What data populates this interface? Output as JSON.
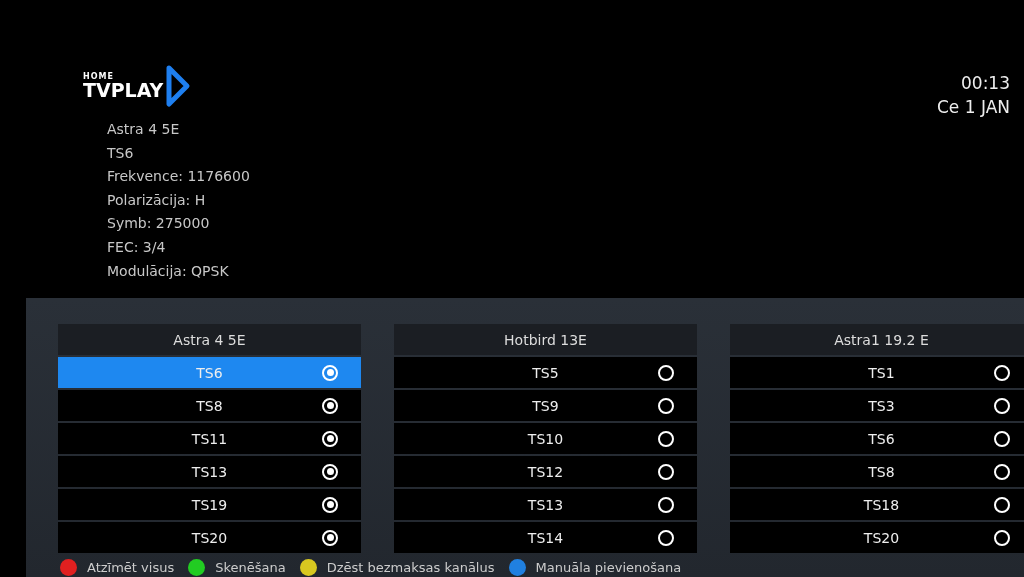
{
  "logo": {
    "small": "HOME",
    "main": "TVPLAY"
  },
  "clock": {
    "time": "00:13",
    "date": "Ce 1 JAN"
  },
  "info": [
    "Astra 4 5E",
    "TS6",
    "Frekvence: 1176600",
    "Polarizācija: H",
    "Symb: 275000",
    "FEC: 3/4",
    "Modulācija: QPSK"
  ],
  "satellites": [
    {
      "name": "Astra 4 5E",
      "transponders": [
        {
          "label": "TS6",
          "selected": true,
          "checked": true
        },
        {
          "label": "TS8",
          "selected": false,
          "checked": true
        },
        {
          "label": "TS11",
          "selected": false,
          "checked": true
        },
        {
          "label": "TS13",
          "selected": false,
          "checked": true
        },
        {
          "label": "TS19",
          "selected": false,
          "checked": true
        },
        {
          "label": "TS20",
          "selected": false,
          "checked": true
        }
      ]
    },
    {
      "name": "Hotbird 13E",
      "transponders": [
        {
          "label": "TS5",
          "selected": false,
          "checked": false
        },
        {
          "label": "TS9",
          "selected": false,
          "checked": false
        },
        {
          "label": "TS10",
          "selected": false,
          "checked": false
        },
        {
          "label": "TS12",
          "selected": false,
          "checked": false
        },
        {
          "label": "TS13",
          "selected": false,
          "checked": false
        },
        {
          "label": "TS14",
          "selected": false,
          "checked": false
        }
      ]
    },
    {
      "name": "Astra1 19.2 E",
      "transponders": [
        {
          "label": "TS1",
          "selected": false,
          "checked": false
        },
        {
          "label": "TS3",
          "selected": false,
          "checked": false
        },
        {
          "label": "TS6",
          "selected": false,
          "checked": false
        },
        {
          "label": "TS8",
          "selected": false,
          "checked": false
        },
        {
          "label": "TS18",
          "selected": false,
          "checked": false
        },
        {
          "label": "TS20",
          "selected": false,
          "checked": false
        }
      ]
    }
  ],
  "legend": [
    {
      "label": "Atzīmēt visus",
      "color": "#e02020"
    },
    {
      "label": "Skenēšana",
      "color": "#22cc22"
    },
    {
      "label": "Dzēst bezmaksas kanālus",
      "color": "#d8c820"
    },
    {
      "label": "Manuāla pievienošana",
      "color": "#2080e0"
    }
  ]
}
